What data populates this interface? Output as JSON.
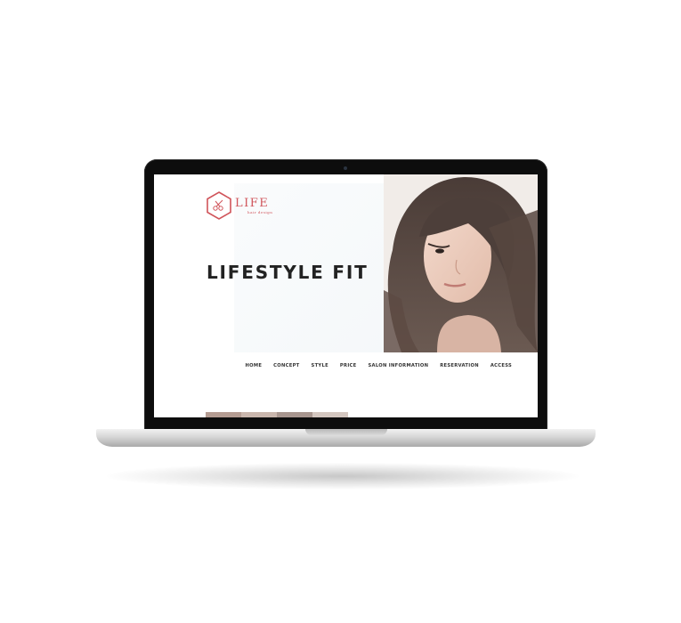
{
  "site": {
    "logo_word": "LIFE",
    "logo_sub": "hair design",
    "logo_icon": "hexagon-scissors-icon",
    "headline": "LIFESTYLE FIT",
    "brand_color": "#d0545a",
    "nav": [
      "HOME",
      "CONCEPT",
      "STYLE",
      "PRICE",
      "SALON INFORMATION",
      "RESERVATION",
      "ACCESS"
    ],
    "gallery_colors": [
      "#b49c92",
      "#c9b6ad",
      "#a8968f",
      "#d3c6bf"
    ]
  },
  "device": {
    "type": "laptop",
    "icon": "laptop-icon"
  }
}
